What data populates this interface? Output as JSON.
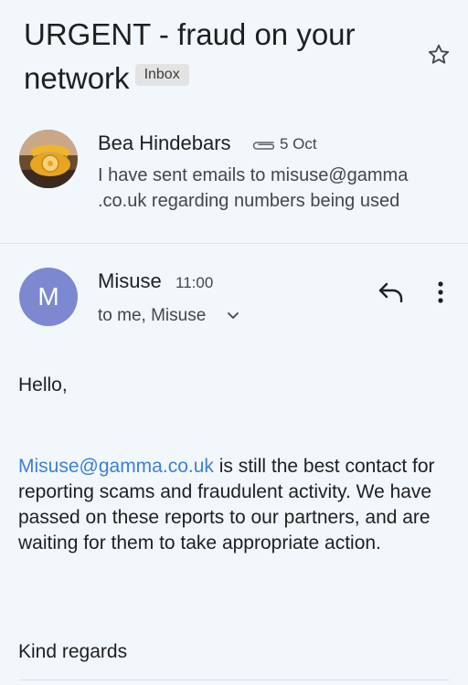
{
  "thread": {
    "subject": "URGENT - fraud on your network",
    "label": "Inbox",
    "star_icon": "star-outline-icon"
  },
  "collapsed_message": {
    "sender": "Bea Hindebars",
    "attachment_icon": "paperclip-icon",
    "date": "5 Oct",
    "snippet": "I have sent emails to misuse@gamma .co.uk regarding numbers being used",
    "avatar": "rotary-phone-photo"
  },
  "expanded_message": {
    "avatar_letter": "M",
    "avatar_color": "#7c89d0",
    "sender": "Misuse",
    "time": "11:00",
    "recipients": "to me, Misuse",
    "reply_icon": "reply-icon",
    "more_icon": "more-vertical-icon",
    "greeting": "Hello,",
    "link_text": "Misuse@gamma.co.uk",
    "body_rest": " is still the best contact for reporting scams and fraudulent activity. We have passed on these reports to our partners, and are waiting for them to take appropriate action.",
    "sign_off": "Kind regards"
  },
  "colors": {
    "background": "#f1f7fb",
    "link": "#3d7fd6",
    "secondary_text": "#444746"
  }
}
